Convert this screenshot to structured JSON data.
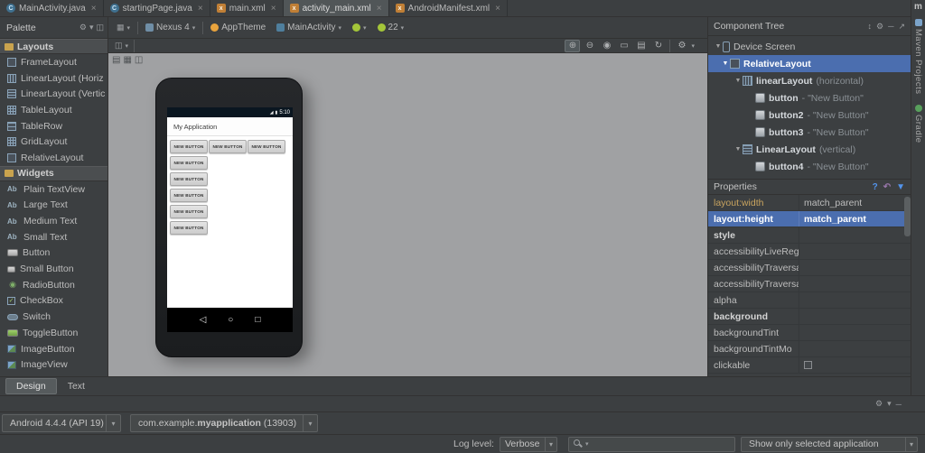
{
  "colors": {
    "selection": "#4b6eaf",
    "canvas": "#a0a1a3",
    "android_green": "#a4c639",
    "accent_blue": "#5394ec",
    "theme_orange": "#e8a33d"
  },
  "icons": {
    "java_glyph": "C",
    "xml_glyph": "x",
    "close": "×",
    "caret": "▾",
    "expand": "▼",
    "gear": "⚙",
    "grid": "▦",
    "panel": "◫",
    "rows": "▤",
    "zoom_in": "⊕",
    "zoom_out": "⊖",
    "zoom_actual": "◉",
    "zoom_fit": "▭",
    "page": "▤",
    "refresh": "↻",
    "help": "?",
    "undo": "↶",
    "filter": "▼",
    "sort": "↕",
    "menu": "≡",
    "minimize": "─",
    "float": "↗",
    "ab": "Ab",
    "radio": "◉",
    "check": "✓",
    "signal": "◢",
    "battery": "▮",
    "nav_back": "◁",
    "nav_home": "○",
    "nav_recents": "□",
    "maven_m": "m"
  },
  "tabs": [
    {
      "label": "MainActivity.java"
    },
    {
      "label": "startingPage.java"
    },
    {
      "label": "main.xml"
    },
    {
      "label": "activity_main.xml"
    },
    {
      "label": "AndroidManifest.xml"
    }
  ],
  "palette": {
    "title": "Palette",
    "sections": [
      {
        "label": "Layouts",
        "items": [
          "FrameLayout",
          "LinearLayout (Horiz",
          "LinearLayout (Vertic",
          "TableLayout",
          "TableRow",
          "GridLayout",
          "RelativeLayout"
        ]
      },
      {
        "label": "Widgets",
        "items": [
          "Plain TextView",
          "Large Text",
          "Medium Text",
          "Small Text",
          "Button",
          "Small Button",
          "RadioButton",
          "CheckBox",
          "Switch",
          "ToggleButton",
          "ImageButton",
          "ImageView"
        ]
      }
    ]
  },
  "toolbar": {
    "device": "Nexus 4",
    "theme": "AppTheme",
    "activity": "MainActivity",
    "api": "22"
  },
  "phone": {
    "time": "5:10",
    "title": "My Application",
    "button": "NEW BUTTON"
  },
  "component_tree": {
    "title": "Component Tree",
    "nodes": [
      {
        "name": "Device Screen",
        "suffix": ""
      },
      {
        "name": "RelativeLayout",
        "suffix": ""
      },
      {
        "name": "linearLayout",
        "suffix": "(horizontal)"
      },
      {
        "name": "button",
        "suffix": "- \"New Button\""
      },
      {
        "name": "button2",
        "suffix": "- \"New Button\""
      },
      {
        "name": "button3",
        "suffix": "- \"New Button\""
      },
      {
        "name": "LinearLayout",
        "suffix": "(vertical)"
      },
      {
        "name": "button4",
        "suffix": "- \"New Button\""
      }
    ]
  },
  "properties": {
    "title": "Properties",
    "rows": [
      {
        "name": "layout:width",
        "value": "match_parent"
      },
      {
        "name": "layout:height",
        "value": "match_parent"
      },
      {
        "name": "style",
        "value": ""
      },
      {
        "name": "accessibilityLiveReg",
        "value": ""
      },
      {
        "name": "accessibilityTraversa",
        "value": ""
      },
      {
        "name": "accessibilityTraversa",
        "value": ""
      },
      {
        "name": "alpha",
        "value": ""
      },
      {
        "name": "background",
        "value": ""
      },
      {
        "name": "backgroundTint",
        "value": ""
      },
      {
        "name": "backgroundTintMo",
        "value": ""
      },
      {
        "name": "clickable",
        "value": ""
      }
    ]
  },
  "bottom": {
    "design": "Design",
    "text": "Text",
    "run_config": "Android 4.4.4 (API 19)",
    "app_prefix": "com.example.",
    "app_name": "myapplication",
    "app_suffix": " (13903)",
    "log_level_label": "Log level:",
    "log_level": "Verbose",
    "show_filter": "Show only selected application"
  },
  "tool_strip": {
    "maven": "Maven Projects",
    "gradle": "Gradle"
  }
}
